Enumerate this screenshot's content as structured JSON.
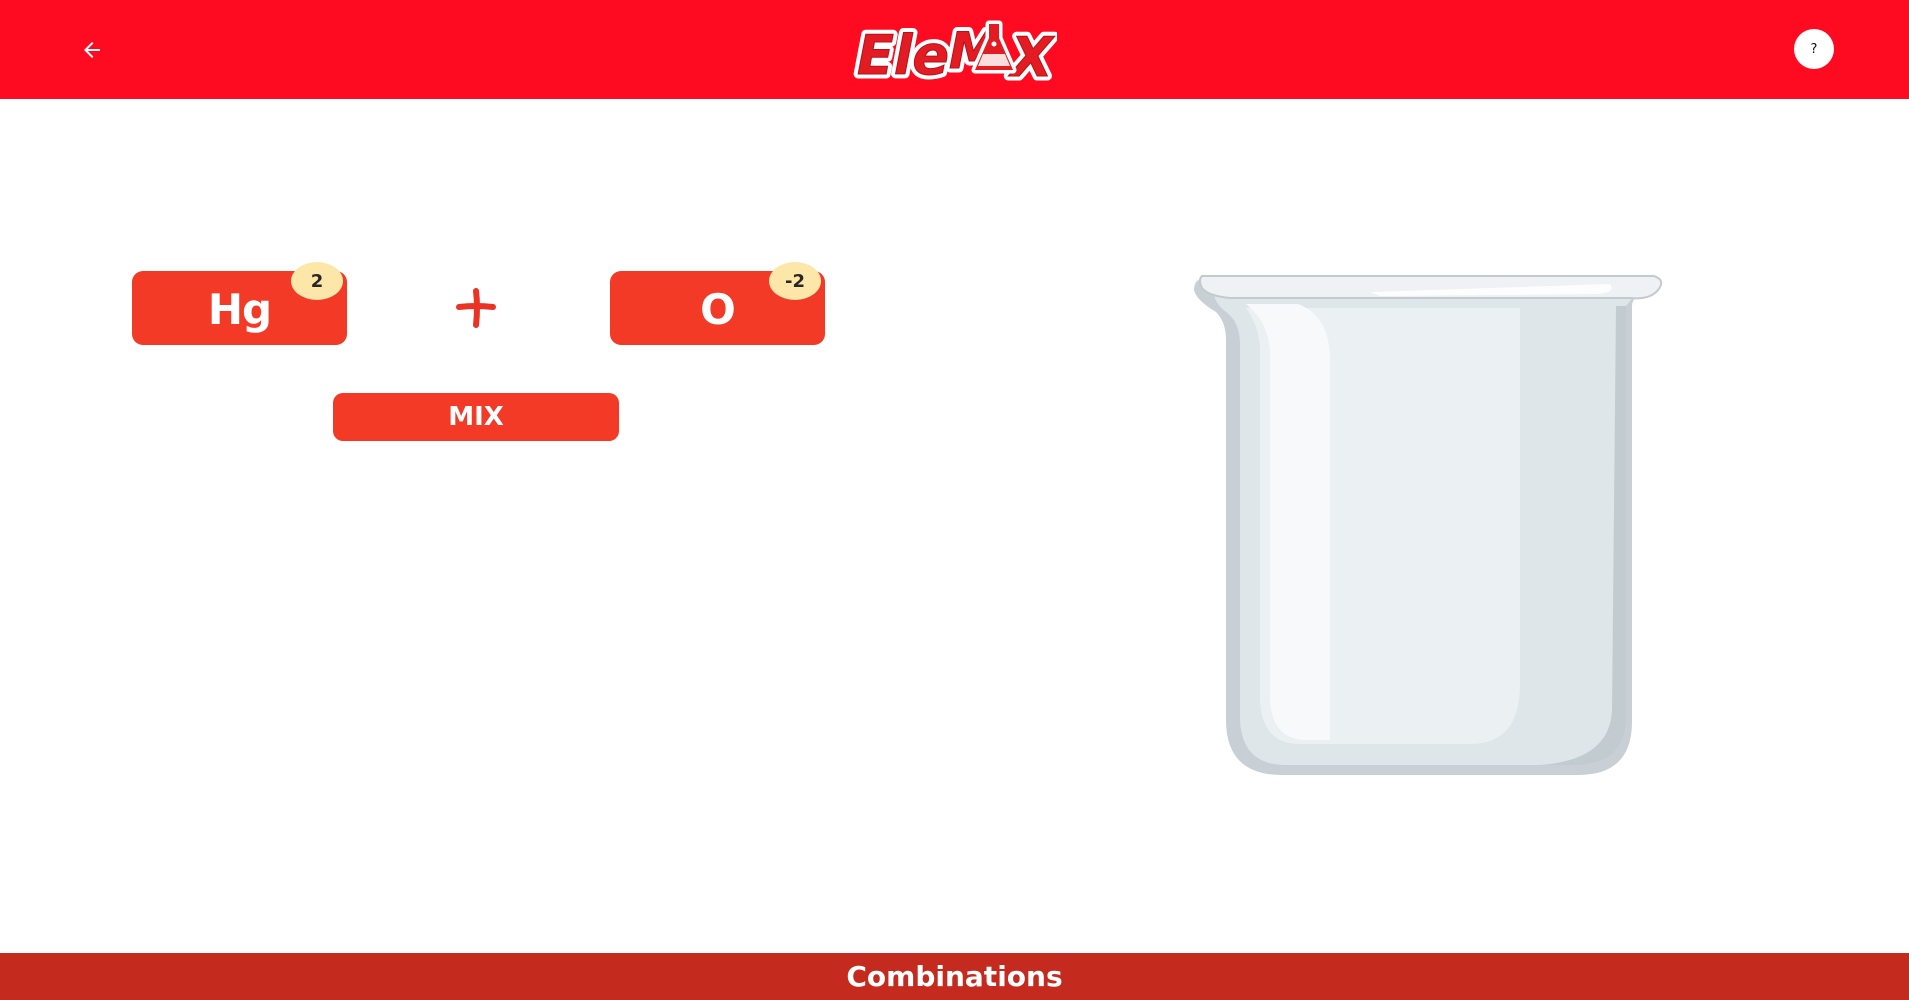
{
  "header": {
    "logo_text": "EleMAX",
    "back_icon": "arrow-left-icon",
    "help_label": "?"
  },
  "elements": {
    "left": {
      "symbol": "Hg",
      "charge": "2"
    },
    "right": {
      "symbol": "O",
      "charge": "-2"
    }
  },
  "operator": {
    "icon": "plus-icon"
  },
  "mix_button": {
    "label": "MIX"
  },
  "footer": {
    "label": "Combinations"
  },
  "colors": {
    "header_bg": "#ff0b21",
    "card_bg": "#f23a26",
    "badge_bg": "#fce7a8",
    "footer_bg": "#c42a1e"
  }
}
